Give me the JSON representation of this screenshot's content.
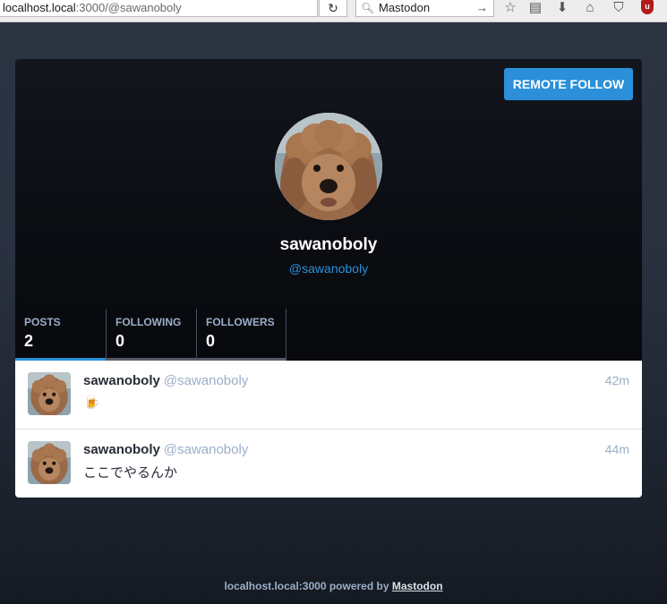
{
  "browser": {
    "url_host": "localhost.local",
    "url_path": ":3000/@sawanoboly",
    "search_query": "Mastodon"
  },
  "profile": {
    "remote_follow_label": "REMOTE FOLLOW",
    "display_name": "sawanoboly",
    "username": "@sawanoboly",
    "counters": [
      {
        "label": "POSTS",
        "value": "2"
      },
      {
        "label": "FOLLOWING",
        "value": "0"
      },
      {
        "label": "FOLLOWERS",
        "value": "0"
      }
    ]
  },
  "statuses": [
    {
      "display_name": "sawanoboly",
      "acct": "@sawanoboly",
      "time": "42m",
      "content": "🍺"
    },
    {
      "display_name": "sawanoboly",
      "acct": "@sawanoboly",
      "time": "44m",
      "content": "ここでやるんか"
    }
  ],
  "footer": {
    "domain": "localhost.local:3000",
    "powered_by": "powered by",
    "link": "Mastodon"
  },
  "colors": {
    "accent": "#2b90d9",
    "muted": "#9baec8"
  }
}
